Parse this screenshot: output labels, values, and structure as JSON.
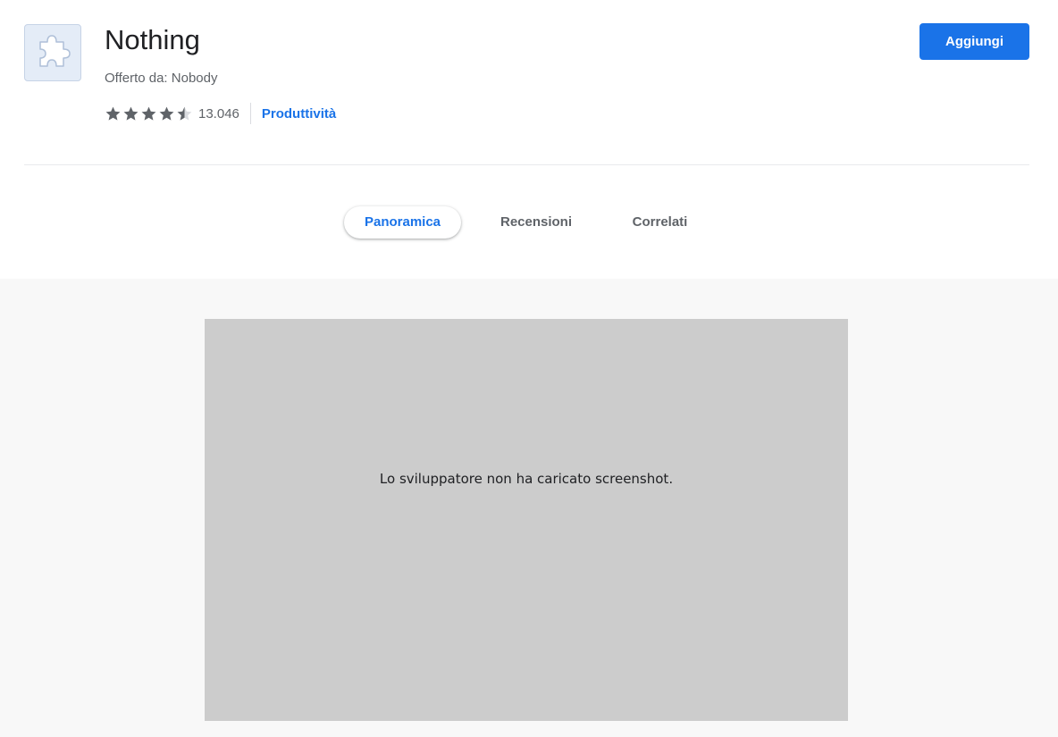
{
  "extension": {
    "name": "Nothing",
    "offered_by": "Offerto da: Nobody",
    "icon": "puzzle-piece-icon",
    "rating": 4.5,
    "rating_max": 5,
    "rating_count": "13.046",
    "category": "Produttività"
  },
  "actions": {
    "add_label": "Aggiungi"
  },
  "tabs": [
    {
      "label": "Panoramica",
      "active": true
    },
    {
      "label": "Recensioni",
      "active": false
    },
    {
      "label": "Correlati",
      "active": false
    }
  ],
  "screenshots": {
    "empty_message": "Lo sviluppatore non ha caricato screenshot."
  },
  "colors": {
    "accent": "#1a73e8",
    "star": "#5f6368",
    "placeholder_bg": "#cccccc"
  }
}
